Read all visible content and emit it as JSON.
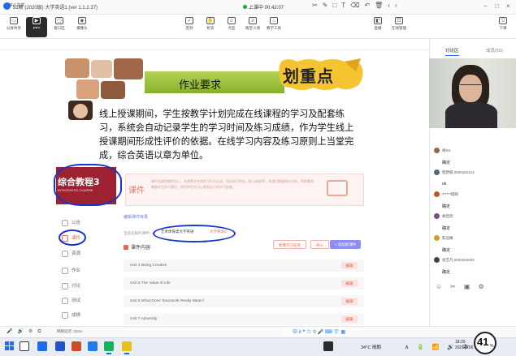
{
  "window": {
    "title": "51教 (2020级) 大学英语1 (ver 1.1.2.37)",
    "recording_text": "上课中 00:42:07",
    "controls": [
      "−",
      "□",
      "×"
    ]
  },
  "toolbar": {
    "left": [
      {
        "label": "分屏共享",
        "icon": "screen-share-icon"
      },
      {
        "label": "PPT",
        "icon": "ppt-icon",
        "active": true
      },
      {
        "label": "窗口区",
        "icon": "window-icon"
      },
      {
        "label": "摄像头",
        "icon": "camera-icon"
      }
    ],
    "middle": [
      {
        "label": "签到",
        "icon": "checkin-icon"
      },
      {
        "label": "抢答",
        "icon": "hand-icon"
      },
      {
        "label": "点名",
        "icon": "rollcall-icon"
      },
      {
        "label": "随堂小测",
        "icon": "quiz-icon"
      },
      {
        "label": "教学工具",
        "icon": "tools-icon"
      }
    ],
    "right": [
      {
        "label": "直播",
        "icon": "live-icon"
      },
      {
        "label": "在线管理",
        "icon": "manage-icon"
      }
    ],
    "far_right": {
      "label": "下课",
      "icon": "end-class-icon"
    }
  },
  "share_bar": {
    "stop_label": "停止共享",
    "annotation_icons": [
      "✂",
      "✎",
      "□",
      "T",
      "⌫",
      "↶",
      "🗑",
      "‹",
      "›"
    ]
  },
  "slide": {
    "heading": "作业要求",
    "highlight": "划重点",
    "body": "线上授课期间，学生按教学计划完成在线课程的学习及配套练习，系统会自动记录学生的学习时间及练习成绩，作为学生线上授课期间形成性评价的依据。在线学习内容及练习原则上当堂完成，综合英语以章为单位。"
  },
  "course": {
    "book_title": "综合教程3",
    "book_sub": "INTEGRATED COURSE",
    "menu": [
      {
        "label": "公告",
        "icon": "notice-icon"
      },
      {
        "label": "课件",
        "icon": "courseware-icon",
        "active": true
      },
      {
        "label": "资源",
        "icon": "resource-icon"
      },
      {
        "label": "作业",
        "icon": "homework-icon"
      },
      {
        "label": "讨论",
        "icon": "discuss-icon"
      },
      {
        "label": "测试",
        "icon": "test-icon"
      },
      {
        "label": "成绩",
        "icon": "grade-icon"
      }
    ],
    "panel_label": "课件",
    "panel_desc": "课件由课程教师导入，系统将学生的学习行为记录，包括学习时长、练习成绩等，并通过数据统计分析，帮助教师掌握学生学习情况，同时学生也可以看到自己的学习进度。",
    "unit_link": "编辑课件目录",
    "filter_label": "当前选择的课件：",
    "filter_tabs": [
      "艺术体育类大学英语",
      "大学英语3"
    ],
    "btn_add": "新增学习任务",
    "btn_import": "导入",
    "btn_new": "+ 添加新课件",
    "content_head": "课件内容",
    "units": [
      {
        "title": "Unit 4 Being Creative",
        "btn": "编辑"
      },
      {
        "title": "Unit 5 The Value of Life",
        "btn": "编辑"
      },
      {
        "title": "Unit 6 What Does Teamwork Really Mean?",
        "btn": "编辑"
      },
      {
        "title": "Unit 7 Adversity",
        "btn": "编辑"
      }
    ]
  },
  "right_panel": {
    "tabs": [
      "讨论区",
      "成员(50)"
    ],
    "chats": [
      {
        "name": "胡XX",
        "text": "确定"
      },
      {
        "name": "程梦楠 2020101414",
        "text": "ok"
      },
      {
        "name": "TT***翔翔",
        "text": "确定"
      },
      {
        "name": "胡佳欣",
        "text": "确定"
      },
      {
        "name": "陈冠峰",
        "text": "确定"
      },
      {
        "name": "张艺凡 2020101022",
        "text": "确定"
      }
    ],
    "bottom_icons": [
      "☺",
      "✂",
      "▣",
      "⚙"
    ]
  },
  "app_footer": {
    "icons": [
      "🎤",
      "🔊",
      "⚙",
      "⧉"
    ],
    "text": "网络延迟: 32ms",
    "ime": "中 ∂ ❝ ☆ ⚲ 🎤 ⌨ 👕 ▦"
  },
  "taskbar": {
    "weather": "34°C 晴朗",
    "sys_icons": "∧ 🔋 📶 🔊 中",
    "time": "18:20",
    "date": "2021/9/26",
    "net_value": "41",
    "net_unit": "%"
  }
}
